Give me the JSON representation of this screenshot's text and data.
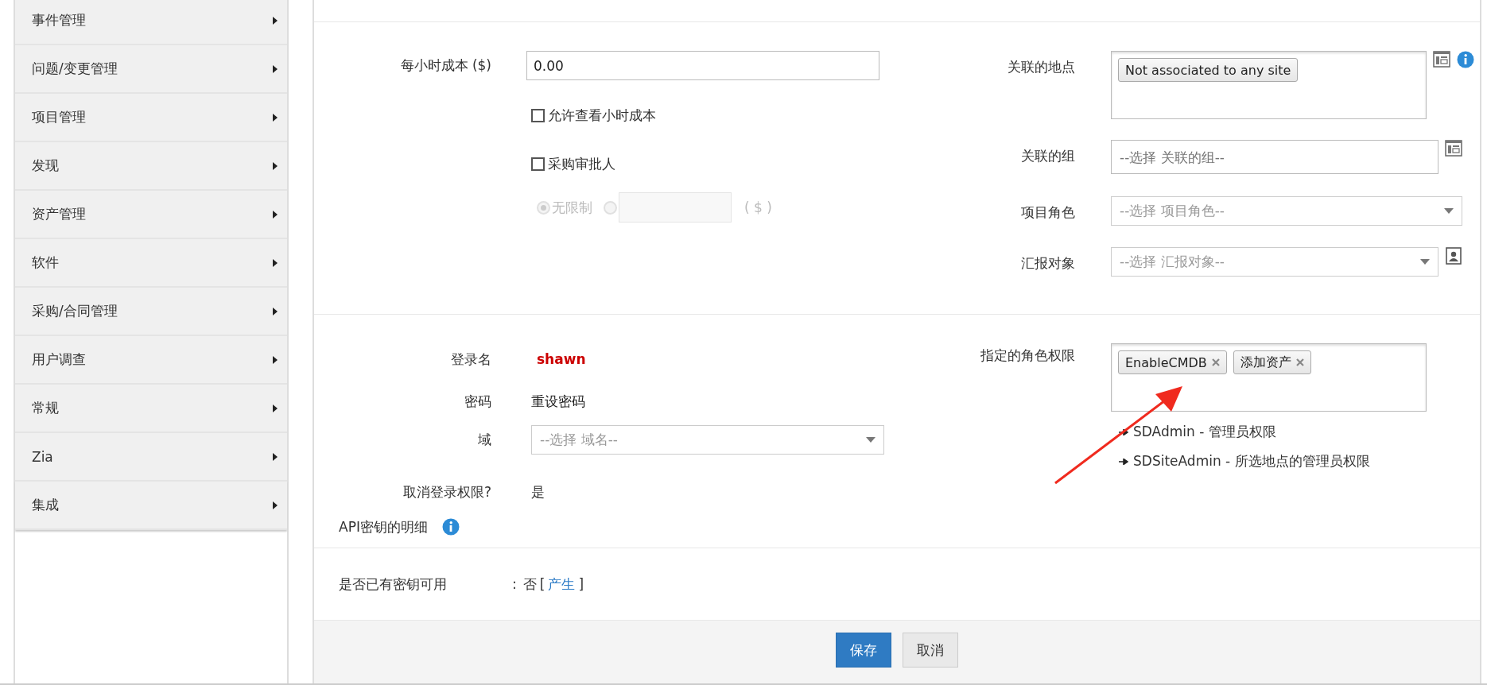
{
  "sidebar": {
    "items": [
      {
        "label": "事件管理"
      },
      {
        "label": "问题/变更管理"
      },
      {
        "label": "项目管理"
      },
      {
        "label": "发现"
      },
      {
        "label": "资产管理"
      },
      {
        "label": "软件"
      },
      {
        "label": "采购/合同管理"
      },
      {
        "label": "用户调查"
      },
      {
        "label": "常规"
      },
      {
        "label": "Zia"
      },
      {
        "label": "集成"
      }
    ]
  },
  "cost": {
    "label": "每小时成本 ($)",
    "value": "0.00"
  },
  "checkboxes": [
    {
      "label": "允许查看小时成本",
      "checked": false
    },
    {
      "label": "采购审批人",
      "checked": false
    }
  ],
  "approval_limit": {
    "disabled": true,
    "options": [
      {
        "kind": "label",
        "label": "无限制",
        "selected": true
      },
      {
        "kind": "amount",
        "selected": false,
        "suffix": "( $ )"
      }
    ]
  },
  "right_fields": [
    {
      "kind": "tags",
      "label": "关联的地点",
      "tags": [
        "Not associated to any site"
      ]
    },
    {
      "kind": "text",
      "label": "关联的组",
      "placeholder": "--选择 关联的组--"
    },
    {
      "kind": "select",
      "label": "项目角色",
      "placeholder": "--选择 项目角色--"
    },
    {
      "kind": "user_select",
      "label": "汇报对象",
      "placeholder": "--选择 汇报对象--"
    }
  ],
  "login": {
    "label": "登录名",
    "value": "shawn"
  },
  "password": {
    "label": "密码",
    "link": "重设密码"
  },
  "domain": {
    "label": "域",
    "placeholder": "--选择 域名--"
  },
  "revoke": {
    "label": "取消登录权限?",
    "value": "是"
  },
  "api_heading": "API密钥的明细",
  "roles": {
    "label": "指定的角色权限",
    "tags": [
      "EnableCMDB",
      "添加资产"
    ],
    "options": [
      "SDAdmin - 管理员权限",
      "SDSiteAdmin - 所选地点的管理员权限"
    ]
  },
  "api_key": {
    "label": "是否已有密钥可用",
    "separator": ":",
    "value": "否",
    "open_bracket": "[",
    "link": "产生",
    "close_bracket": "]"
  },
  "buttons": [
    {
      "kind": "primary",
      "label": "保存"
    },
    {
      "kind": "secondary",
      "label": "取消"
    }
  ]
}
